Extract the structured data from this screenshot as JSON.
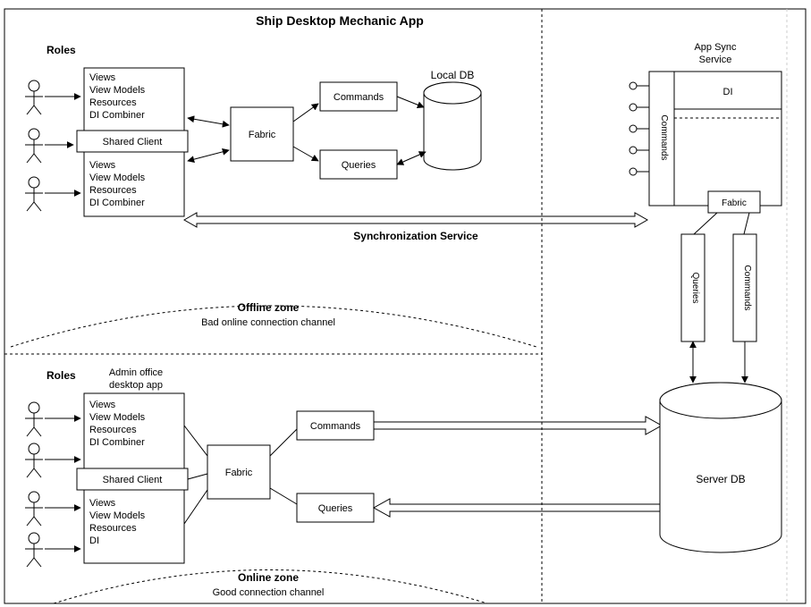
{
  "title": "Ship Desktop Mechanic App",
  "offline": {
    "roles_label": "Roles",
    "client": {
      "shared_client": "Shared Client",
      "modA": {
        "l1": "Views",
        "l2": "View Models",
        "l3": "Resources",
        "l4": "DI Combiner"
      },
      "modB": {
        "l1": "Views",
        "l2": "View Models",
        "l3": "Resources",
        "l4": "DI Combiner"
      }
    },
    "fabric": "Fabric",
    "commands": "Commands",
    "queries": "Queries",
    "local_db": "Local DB",
    "sync_label": "Synchronization Service",
    "zone_title": "Offline zone",
    "zone_sub": "Bad online connection channel"
  },
  "online": {
    "roles_label": "Roles",
    "app_title": "Admin office\ndesktop app",
    "client": {
      "shared_client": "Shared Client",
      "modA": {
        "l1": "Views",
        "l2": "View Models",
        "l3": "Resources",
        "l4": "DI Combiner"
      },
      "modB": {
        "l1": "Views",
        "l2": "View Models",
        "l3": "Resources",
        "l4": "DI"
      }
    },
    "fabric": "Fabric",
    "commands": "Commands",
    "queries": "Queries",
    "zone_title": "Online zone",
    "zone_sub": "Good connection channel"
  },
  "app_sync": {
    "title": "App Sync\nService",
    "di": "DI",
    "commands_label": "Commands",
    "fabric": "Fabric"
  },
  "queries_v": "Queries",
  "commands_v": "Commands",
  "server_db": "Server DB"
}
